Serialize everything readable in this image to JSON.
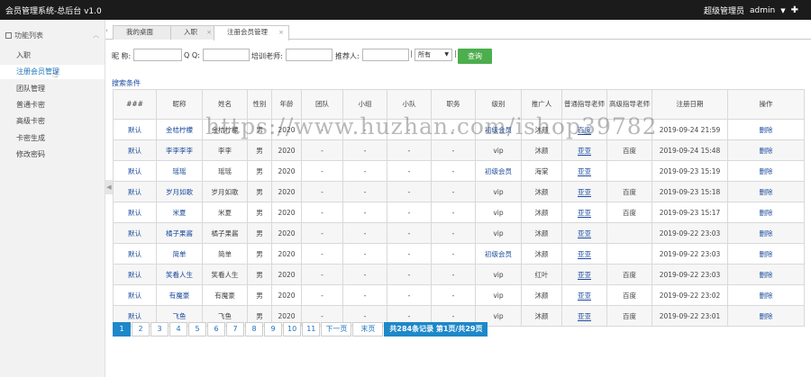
{
  "header": {
    "app_title": "会员管理系统-总后台  v1.0",
    "role": "超级管理员",
    "user": "admin",
    "caret": "▼",
    "settings_icon": "✚"
  },
  "sidebar": {
    "heading": "功能列表",
    "items": [
      {
        "label": "入职"
      },
      {
        "label": "注册会员管理"
      },
      {
        "label": "团队管理"
      },
      {
        "label": "普通卡密"
      },
      {
        "label": "高级卡密"
      },
      {
        "label": "卡密生成"
      },
      {
        "label": "修改密码"
      }
    ]
  },
  "tabs": [
    {
      "label": "我的桌面"
    },
    {
      "label": "入职"
    },
    {
      "label": "注册会员管理"
    }
  ],
  "search": {
    "nickname_label": "昵 称:",
    "nickname_value": "",
    "qq_label": "Q Q:",
    "qq_value": "",
    "trainer_label": "培训老师:",
    "trainer_value": "",
    "referrer_label": "推荐人:",
    "referrer_value": "",
    "level_selected": "所有",
    "submit": "查询"
  },
  "search_cond": "搜索条件",
  "table": {
    "columns": [
      "###",
      "昵称",
      "姓名",
      "性别",
      "年龄",
      "团队",
      "小组",
      "小队",
      "职务",
      "级别",
      "推广人",
      "普通指导老师",
      "高级指导老师",
      "注册日期",
      "操作"
    ],
    "rows": [
      {
        "id": "默认",
        "nick": "金桔柠檬",
        "name": "金桔柠檬",
        "sex": "男",
        "age": "2020",
        "team": "-",
        "group": "-",
        "squad": "-",
        "duty": "-",
        "level": "初级会员",
        "promoter": "沐颜",
        "normal": "百度",
        "senior": "",
        "date": "2019-09-24 21:59",
        "op": "删除"
      },
      {
        "id": "默认",
        "nick": "李李李李",
        "name": "李李",
        "sex": "男",
        "age": "2020",
        "team": "-",
        "group": "-",
        "squad": "-",
        "duty": "-",
        "level": "vip",
        "promoter": "沐颜",
        "normal": "亚亚",
        "senior": "百度",
        "date": "2019-09-24 15:48",
        "op": "删除"
      },
      {
        "id": "默认",
        "nick": "瑶瑶",
        "name": "瑶瑶",
        "sex": "男",
        "age": "2020",
        "team": "-",
        "group": "-",
        "squad": "-",
        "duty": "-",
        "level": "初级会员",
        "promoter": "海棠",
        "normal": "亚亚",
        "senior": "",
        "date": "2019-09-23 15:19",
        "op": "删除"
      },
      {
        "id": "默认",
        "nick": "岁月如歌",
        "name": "岁月如歌",
        "sex": "男",
        "age": "2020",
        "team": "-",
        "group": "-",
        "squad": "-",
        "duty": "-",
        "level": "vip",
        "promoter": "沐颜",
        "normal": "亚亚",
        "senior": "百度",
        "date": "2019-09-23 15:18",
        "op": "删除"
      },
      {
        "id": "默认",
        "nick": "米夏",
        "name": "米夏",
        "sex": "男",
        "age": "2020",
        "team": "-",
        "group": "-",
        "squad": "-",
        "duty": "-",
        "level": "vip",
        "promoter": "沐颜",
        "normal": "亚亚",
        "senior": "百度",
        "date": "2019-09-23 15:17",
        "op": "删除"
      },
      {
        "id": "默认",
        "nick": "橘子果酱",
        "name": "橘子果酱",
        "sex": "男",
        "age": "2020",
        "team": "-",
        "group": "-",
        "squad": "-",
        "duty": "-",
        "level": "vip",
        "promoter": "沐颜",
        "normal": "亚亚",
        "senior": "",
        "date": "2019-09-22 23:03",
        "op": "删除"
      },
      {
        "id": "默认",
        "nick": "简单",
        "name": "简单",
        "sex": "男",
        "age": "2020",
        "team": "-",
        "group": "-",
        "squad": "-",
        "duty": "-",
        "level": "初级会员",
        "promoter": "沐颜",
        "normal": "亚亚",
        "senior": "",
        "date": "2019-09-22 23:03",
        "op": "删除"
      },
      {
        "id": "默认",
        "nick": "笑看人生",
        "name": "笑看人生",
        "sex": "男",
        "age": "2020",
        "team": "-",
        "group": "-",
        "squad": "-",
        "duty": "-",
        "level": "vip",
        "promoter": "红叶",
        "normal": "亚亚",
        "senior": "百度",
        "date": "2019-09-22 23:03",
        "op": "删除"
      },
      {
        "id": "默认",
        "nick": "有魔豪",
        "name": "有魔豪",
        "sex": "男",
        "age": "2020",
        "team": "-",
        "group": "-",
        "squad": "-",
        "duty": "-",
        "level": "vip",
        "promoter": "沐颜",
        "normal": "亚亚",
        "senior": "百度",
        "date": "2019-09-22 23:02",
        "op": "删除"
      },
      {
        "id": "默认",
        "nick": "飞鱼",
        "name": "飞鱼",
        "sex": "男",
        "age": "2020",
        "team": "-",
        "group": "-",
        "squad": "-",
        "duty": "-",
        "level": "vip",
        "promoter": "沐颜",
        "normal": "亚亚",
        "senior": "百度",
        "date": "2019-09-22 23:01",
        "op": "删除"
      }
    ]
  },
  "pager": {
    "pages": [
      "1",
      "2",
      "3",
      "4",
      "5",
      "6",
      "7",
      "8",
      "9",
      "10",
      "11"
    ],
    "next": "下一页",
    "last": "末页",
    "info": "共284条记录 第1页/共29页"
  },
  "watermark": "https://www.huzhan.com/ishop39782"
}
